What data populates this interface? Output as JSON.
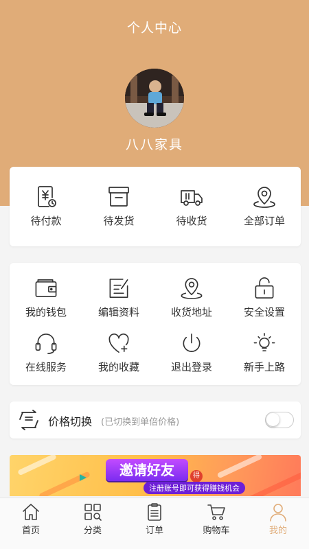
{
  "header": {
    "title": "个人中心"
  },
  "profile": {
    "name": "八八家具"
  },
  "orders": [
    {
      "label": "待付款",
      "icon": "pending-payment-icon"
    },
    {
      "label": "待发货",
      "icon": "box-icon"
    },
    {
      "label": "待收货",
      "icon": "truck-icon"
    },
    {
      "label": "全部订单",
      "icon": "location-pin-icon"
    }
  ],
  "tools": [
    {
      "label": "我的钱包",
      "icon": "wallet-icon"
    },
    {
      "label": "编辑资料",
      "icon": "edit-icon"
    },
    {
      "label": "收货地址",
      "icon": "address-pin-icon"
    },
    {
      "label": "安全设置",
      "icon": "lock-icon"
    },
    {
      "label": "在线服务",
      "icon": "headset-icon"
    },
    {
      "label": "我的收藏",
      "icon": "heart-plus-icon"
    },
    {
      "label": "退出登录",
      "icon": "power-icon"
    },
    {
      "label": "新手上路",
      "icon": "bulb-icon"
    }
  ],
  "price_switch": {
    "label": "价格切换",
    "hint": "(已切换到单倍价格)",
    "on": false
  },
  "banner": {
    "title": "邀请好友",
    "badge": "得",
    "subtitle": "注册账号即可获得赚钱机会"
  },
  "tabbar": [
    {
      "label": "首页",
      "icon": "home-icon",
      "active": false
    },
    {
      "label": "分类",
      "icon": "category-icon",
      "active": false
    },
    {
      "label": "订单",
      "icon": "clipboard-icon",
      "active": false
    },
    {
      "label": "购物车",
      "icon": "cart-icon",
      "active": false
    },
    {
      "label": "我的",
      "icon": "user-icon",
      "active": true
    }
  ],
  "colors": {
    "accent": "#e0ac78",
    "background": "#f4f4f4"
  }
}
